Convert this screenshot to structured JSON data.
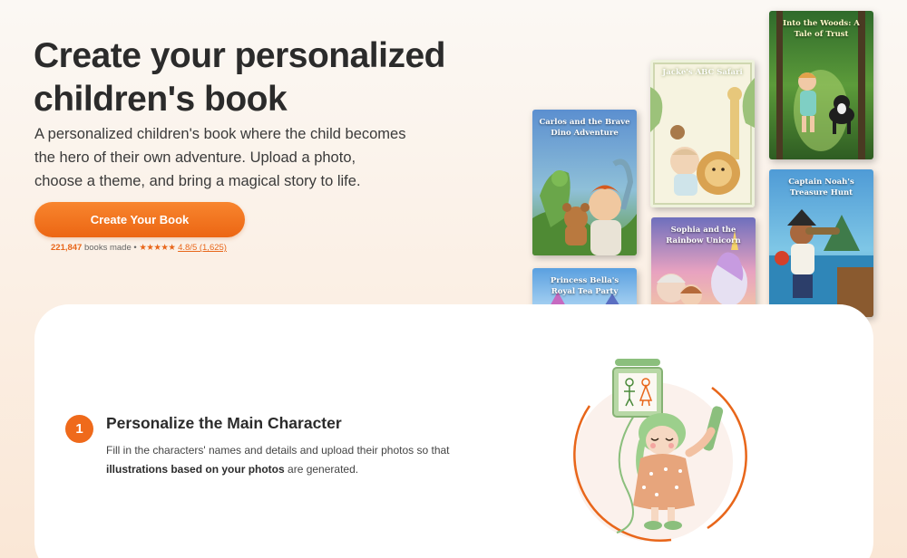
{
  "hero": {
    "title": "Create your personalized children's book",
    "subtitle": "A personalized children's book where the child becomes the hero of their own adventure. Upload a photo, choose a theme, and bring a magical story to life.",
    "cta_label": "Create Your Book",
    "books_count": "221,847",
    "books_count_suffix": "books made",
    "separator": "•",
    "stars": "★★★★★",
    "rating": "4.8/5 (1,625)"
  },
  "books": [
    {
      "title": "Carlos and the Brave Dino Adventure"
    },
    {
      "title": "Jacke's ABC Safari"
    },
    {
      "title": "Into the Woods: A Tale of Trust"
    },
    {
      "title": "Sophia and the Rainbow Unicorn"
    },
    {
      "title": "Captain Noah's Treasure Hunt"
    },
    {
      "title": "Princess Bella's Royal Tea Party"
    }
  ],
  "step": {
    "number": "1",
    "title": "Personalize the Main Character",
    "desc_before": "Fill in the characters' names and details and upload their photos so that ",
    "desc_bold": "illustrations based on your photos",
    "desc_after": " are generated."
  },
  "colors": {
    "accent": "#ef6a1b",
    "background": "#fbeee2",
    "card": "#ffffff"
  }
}
